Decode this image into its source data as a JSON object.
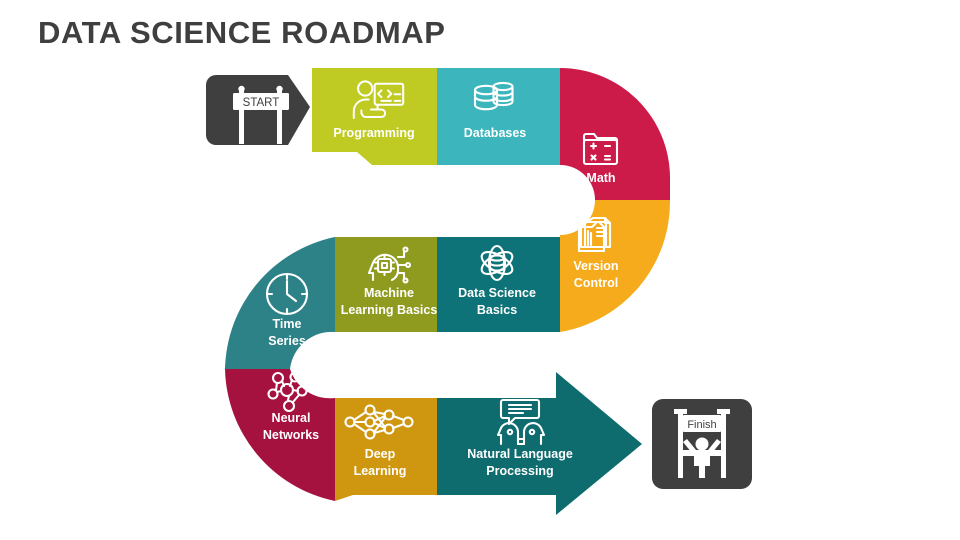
{
  "page": {
    "title": "DATA SCIENCE ROADMAP",
    "background": "#ffffff",
    "title_color": "#3f3f3f"
  },
  "markers": {
    "start": {
      "label": "START",
      "icon": "start-signpost-icon",
      "color": "#3f3f3f"
    },
    "finish": {
      "label": "Finish",
      "icon": "finish-line-runner-icon",
      "color": "#3f3f3f"
    }
  },
  "roadmap": {
    "steps": [
      {
        "id": "programming",
        "label": "Programming",
        "label_lines": [
          "Programming"
        ],
        "color": "#bfcb23",
        "icon": "developer-coding-icon",
        "row": "top"
      },
      {
        "id": "databases",
        "label": "Databases",
        "label_lines": [
          "Databases"
        ],
        "color": "#3cb5bd",
        "icon": "database-stack-icon",
        "row": "top"
      },
      {
        "id": "math",
        "label": "Math",
        "label_lines": [
          "Math"
        ],
        "color": "#cc1b48",
        "icon": "math-operations-folder-icon",
        "row": "bend-right"
      },
      {
        "id": "version-control",
        "label": "Version Control",
        "label_lines": [
          "Version",
          "Control"
        ],
        "color": "#f5ab1b",
        "icon": "version-documents-icon",
        "row": "bend-right"
      },
      {
        "id": "data-science-basics",
        "label": "Data Science Basics",
        "label_lines": [
          "Data Science",
          "Basics"
        ],
        "color": "#0e7378",
        "icon": "atom-database-icon",
        "row": "middle"
      },
      {
        "id": "machine-learning-basics",
        "label": "Machine Learning Basics",
        "label_lines": [
          "Machine",
          "Learning Basics"
        ],
        "color": "#8f9b1e",
        "icon": "ai-head-chip-icon",
        "row": "middle"
      },
      {
        "id": "time-series",
        "label": "Time Series",
        "label_lines": [
          "Time",
          "Series"
        ],
        "color": "#2d8287",
        "icon": "clock-icon",
        "row": "bend-left"
      },
      {
        "id": "neural-networks",
        "label": "Neural Networks",
        "label_lines": [
          "Neural",
          "Networks"
        ],
        "color": "#a6123f",
        "icon": "neural-graph-icon",
        "row": "bend-left"
      },
      {
        "id": "deep-learning",
        "label": "Deep Learning",
        "label_lines": [
          "Deep",
          "Learning"
        ],
        "color": "#cf9710",
        "icon": "deep-network-icon",
        "row": "bottom"
      },
      {
        "id": "natural-language-processing",
        "label": "Natural Language Processing",
        "label_lines": [
          "Natural Language",
          "Processing"
        ],
        "color": "#0e6b6e",
        "icon": "nlp-heads-icon",
        "row": "bottom"
      }
    ],
    "direction": "start-to-finish",
    "arrow_color": "#0e6b6e"
  }
}
